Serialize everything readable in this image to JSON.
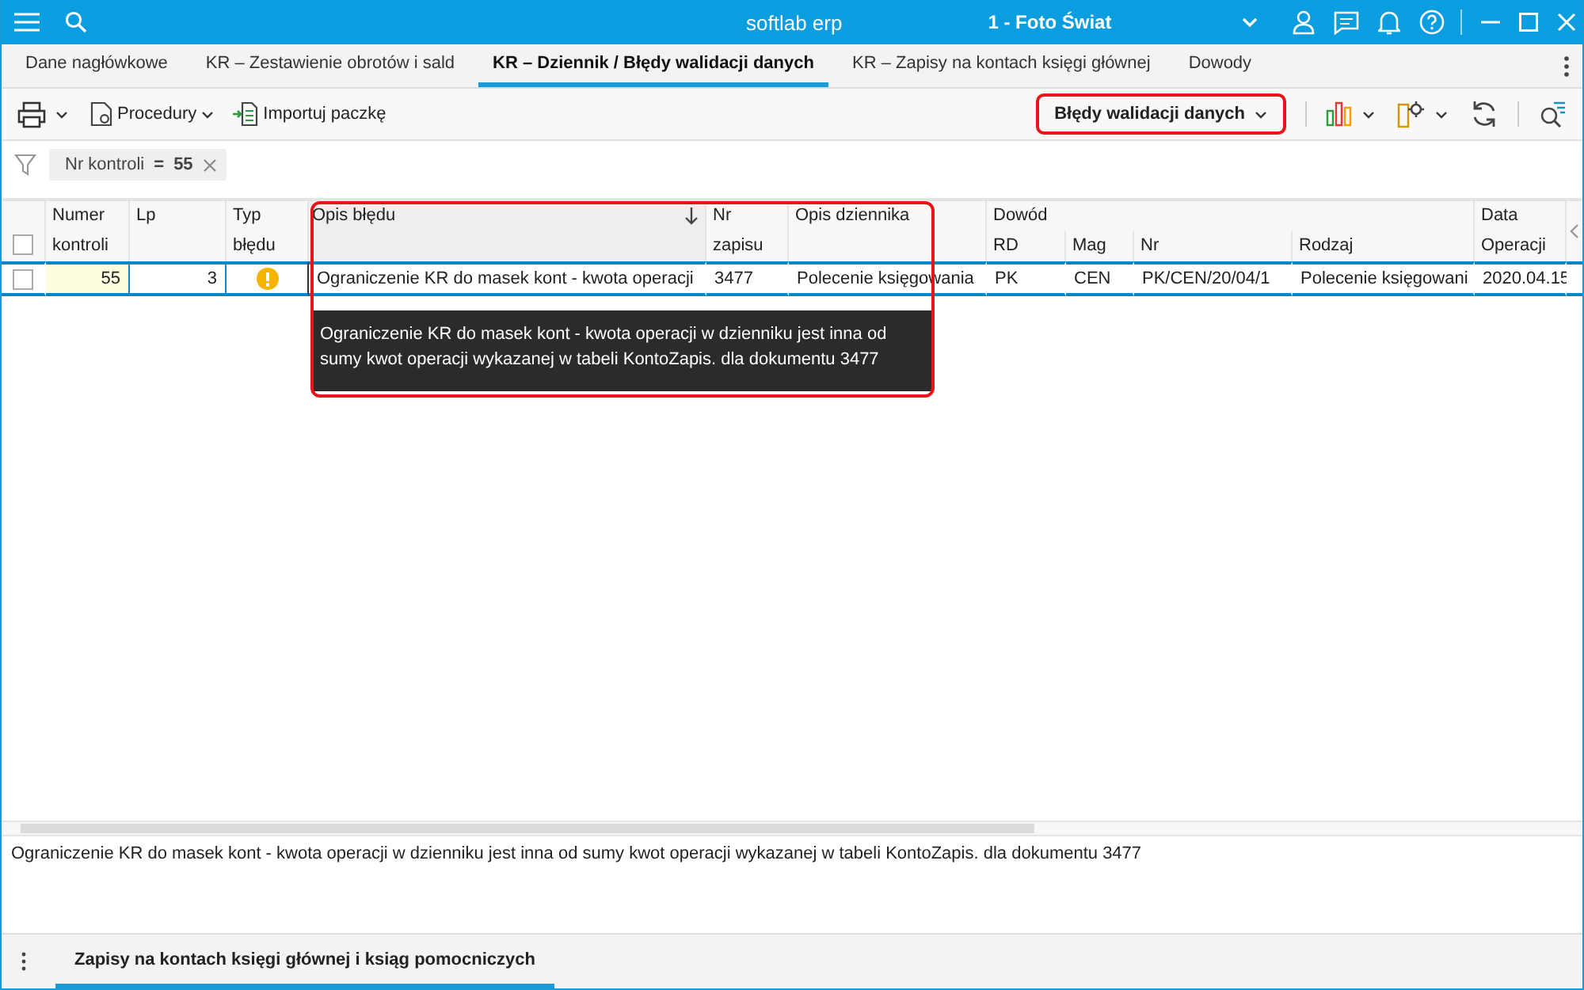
{
  "title_bar": {
    "app": "softlab erp",
    "company": "1 - Foto Świat"
  },
  "tabs": [
    {
      "label": "Dane nagłówkowe",
      "selected": false
    },
    {
      "label": "KR – Zestawienie obrotów i sald",
      "selected": false
    },
    {
      "label": "KR – Dziennik / Błędy walidacji danych",
      "selected": true
    },
    {
      "label": "KR – Zapisy na kontach księgi głównej",
      "selected": false
    },
    {
      "label": "Dowody",
      "selected": false
    }
  ],
  "toolbar": {
    "procedures": "Procedury",
    "import": "Importuj paczkę",
    "view": "Błędy walidacji danych"
  },
  "filter": {
    "field": "Nr kontroli",
    "operator": "=",
    "value": "55"
  },
  "table": {
    "all_checked": false,
    "columns": [
      {
        "label": "Numer kontroli",
        "sorted": false
      },
      {
        "label": "Lp",
        "sorted": false
      },
      {
        "label": "Typ błędu",
        "sorted": false
      },
      {
        "label": "Opis błędu",
        "sorted": true
      },
      {
        "label": "Nr zapisu",
        "sorted": false
      },
      {
        "label": "Opis dziennika",
        "sorted": false
      }
    ],
    "group": {
      "label": "Dowód",
      "columns": [
        "RD",
        "Mag",
        "Nr",
        "Rodzaj"
      ]
    },
    "last_column": {
      "label": "Data Operacji"
    },
    "rows": [
      {
        "selected": true,
        "checked": false,
        "cells": [
          "55",
          "3",
          {
            "warning": true
          },
          "Ograniczenie KR do masek kont - kwota operacji",
          "3477",
          "Polecenie księgowania",
          "PK",
          "CEN",
          "PK/CEN/20/04/1",
          "Polecenie księgowani",
          "2020.04.15"
        ]
      }
    ]
  },
  "tooltip": "Ograniczenie KR do masek kont - kwota operacji w dzienniku jest inna od sumy kwot operacji wykazanej w tabeli KontoZapis. dla dokumentu 3477",
  "description": "Ograniczenie KR do masek kont - kwota operacji w dzienniku jest inna od sumy kwot operacji wykazanej w tabeli KontoZapis. dla dokumentu 3477",
  "bottom_tabs": [
    {
      "label": "Zapisy na kontach księgi głównej i ksiąg pomocniczych",
      "selected": true
    }
  ]
}
